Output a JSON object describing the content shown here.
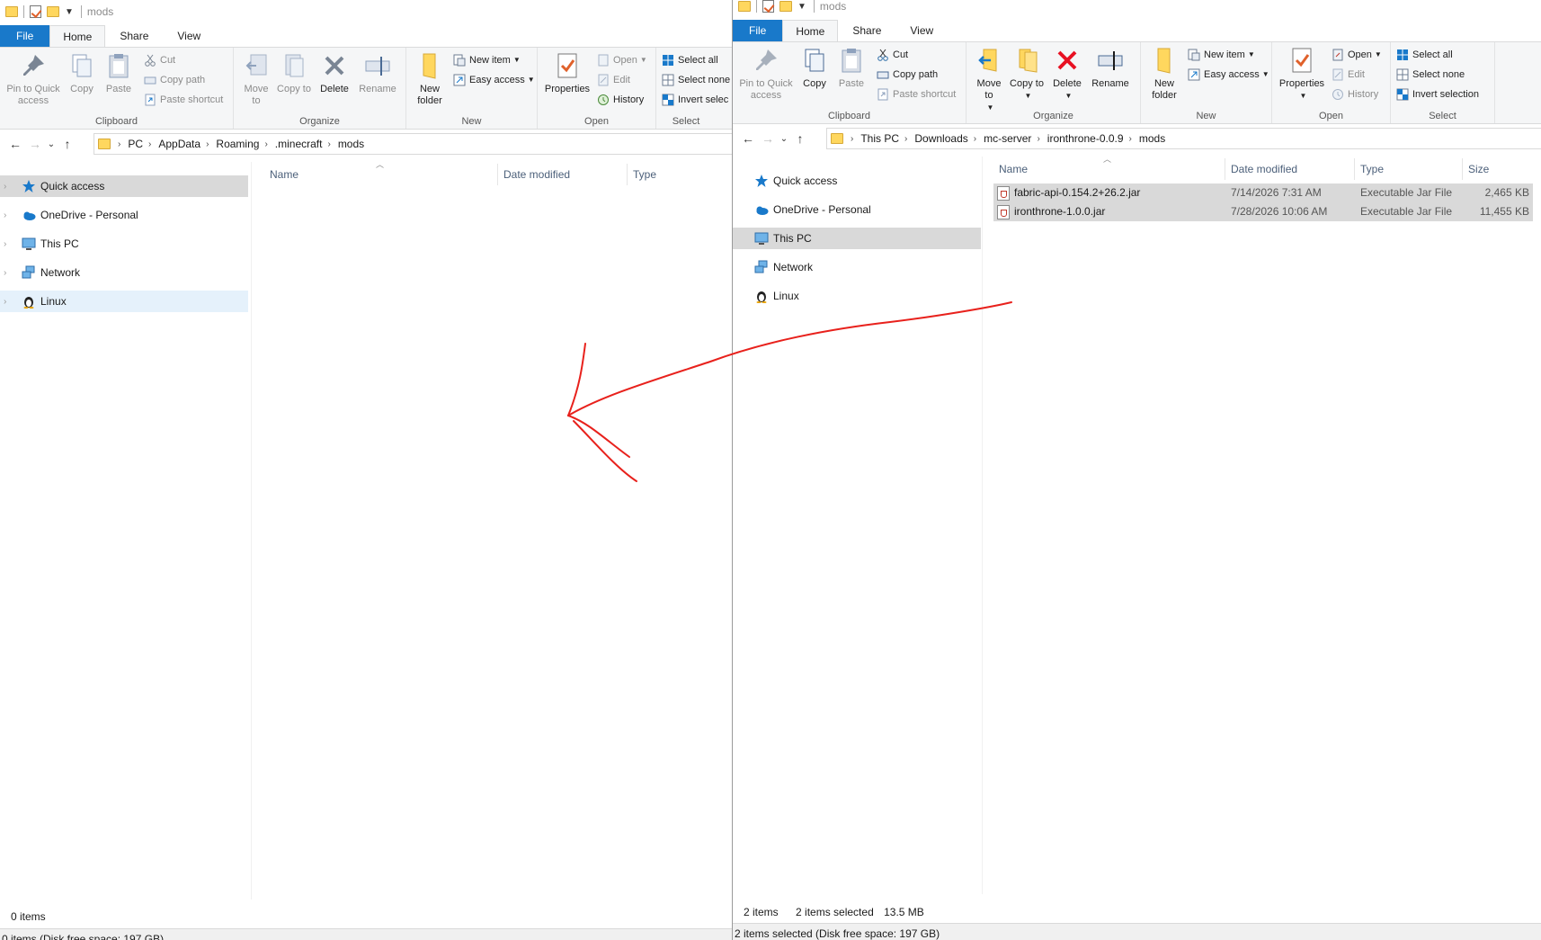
{
  "left": {
    "title": "mods",
    "tabs": [
      "File",
      "Home",
      "Share",
      "View"
    ],
    "ribbon": {
      "clipboard": {
        "label": "Clipboard",
        "pin": "Pin to Quick access",
        "copy": "Copy",
        "paste": "Paste",
        "cut": "Cut",
        "copy_path": "Copy path",
        "paste_shortcut": "Paste shortcut"
      },
      "organize": {
        "label": "Organize",
        "move_to": "Move to",
        "copy_to": "Copy to",
        "delete": "Delete",
        "rename": "Rename"
      },
      "new": {
        "label": "New",
        "new_folder": "New folder",
        "new_item": "New item",
        "easy_access": "Easy access"
      },
      "open": {
        "label": "Open",
        "properties": "Properties",
        "open": "Open",
        "edit": "Edit",
        "history": "History"
      },
      "select": {
        "label": "Select",
        "select_all": "Select all",
        "select_none": "Select none",
        "invert_selection": "Invert selec"
      }
    },
    "path": [
      "PC",
      "AppData",
      "Roaming",
      ".minecraft",
      "mods"
    ],
    "nav": [
      "Quick access",
      "OneDrive - Personal",
      "This PC",
      "Network",
      "Linux"
    ],
    "columns": [
      "Name",
      "Date modified",
      "Type"
    ],
    "status": "0 items",
    "bottom": "0 items (Disk free space: 197 GB)"
  },
  "right": {
    "title": "mods",
    "tabs": [
      "File",
      "Home",
      "Share",
      "View"
    ],
    "ribbon": {
      "clipboard": {
        "label": "Clipboard",
        "pin": "Pin to Quick access",
        "copy": "Copy",
        "paste": "Paste",
        "cut": "Cut",
        "copy_path": "Copy path",
        "paste_shortcut": "Paste shortcut"
      },
      "organize": {
        "label": "Organize",
        "move_to": "Move to",
        "copy_to": "Copy to",
        "delete": "Delete",
        "rename": "Rename"
      },
      "new": {
        "label": "New",
        "new_folder": "New folder",
        "new_item": "New item",
        "easy_access": "Easy access"
      },
      "open": {
        "label": "Open",
        "properties": "Properties",
        "open": "Open",
        "edit": "Edit",
        "history": "History"
      },
      "select": {
        "label": "Select",
        "select_all": "Select all",
        "select_none": "Select none",
        "invert_selection": "Invert selection"
      }
    },
    "path": [
      "This PC",
      "Downloads",
      "mc-server",
      "ironthrone-0.0.9",
      "mods"
    ],
    "nav": [
      "Quick access",
      "OneDrive - Personal",
      "This PC",
      "Network",
      "Linux"
    ],
    "columns": [
      "Name",
      "Date modified",
      "Type",
      "Size"
    ],
    "files": [
      {
        "name": "fabric-api-0.154.2+26.2.jar",
        "date": "7/14/2026 7:31 AM",
        "type": "Executable Jar File",
        "size": "2,465 KB"
      },
      {
        "name": "ironthrone-1.0.0.jar",
        "date": "7/28/2026 10:06 AM",
        "type": "Executable Jar File",
        "size": "11,455 KB"
      }
    ],
    "status": {
      "count": "2 items",
      "selected": "2 items selected",
      "size": "13.5 MB"
    },
    "bottom": "2 items selected (Disk free space: 197 GB)"
  },
  "colors": {
    "file_tab": "#1979ca",
    "selection": "#d9d9d9",
    "annotation": "#e8211c"
  }
}
